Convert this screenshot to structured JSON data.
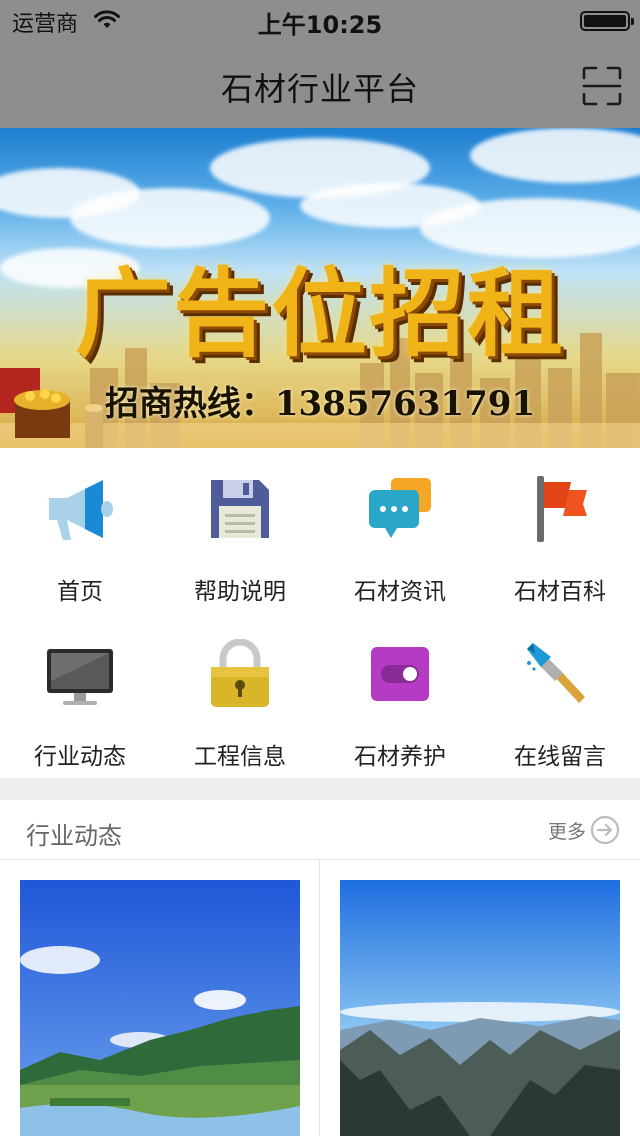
{
  "status_bar": {
    "carrier": "运营商",
    "time": "上午10:25",
    "wifi_icon": "wifi-icon",
    "battery_icon": "battery-icon"
  },
  "nav": {
    "title": "石材行业平台",
    "scan_icon": "scan-icon"
  },
  "banner": {
    "headline": "广告位招租",
    "hotline": "招商热线：13857631791"
  },
  "menu": [
    {
      "label": "首页",
      "icon": "megaphone-icon"
    },
    {
      "label": "帮助说明",
      "icon": "floppy-disk-icon"
    },
    {
      "label": "石材资讯",
      "icon": "chat-bubble-icon"
    },
    {
      "label": "石材百科",
      "icon": "flag-icon"
    },
    {
      "label": "行业动态",
      "icon": "monitor-icon"
    },
    {
      "label": "工程信息",
      "icon": "lock-icon"
    },
    {
      "label": "石材养护",
      "icon": "toggle-icon"
    },
    {
      "label": "在线留言",
      "icon": "paint-brush-icon"
    }
  ],
  "section": {
    "title": "行业动态",
    "more_label": "更多",
    "more_icon": "arrow-right-circle-icon"
  },
  "news_photos": [
    {
      "icon": "landscape-photo-wetland"
    },
    {
      "icon": "landscape-photo-mountains"
    }
  ]
}
